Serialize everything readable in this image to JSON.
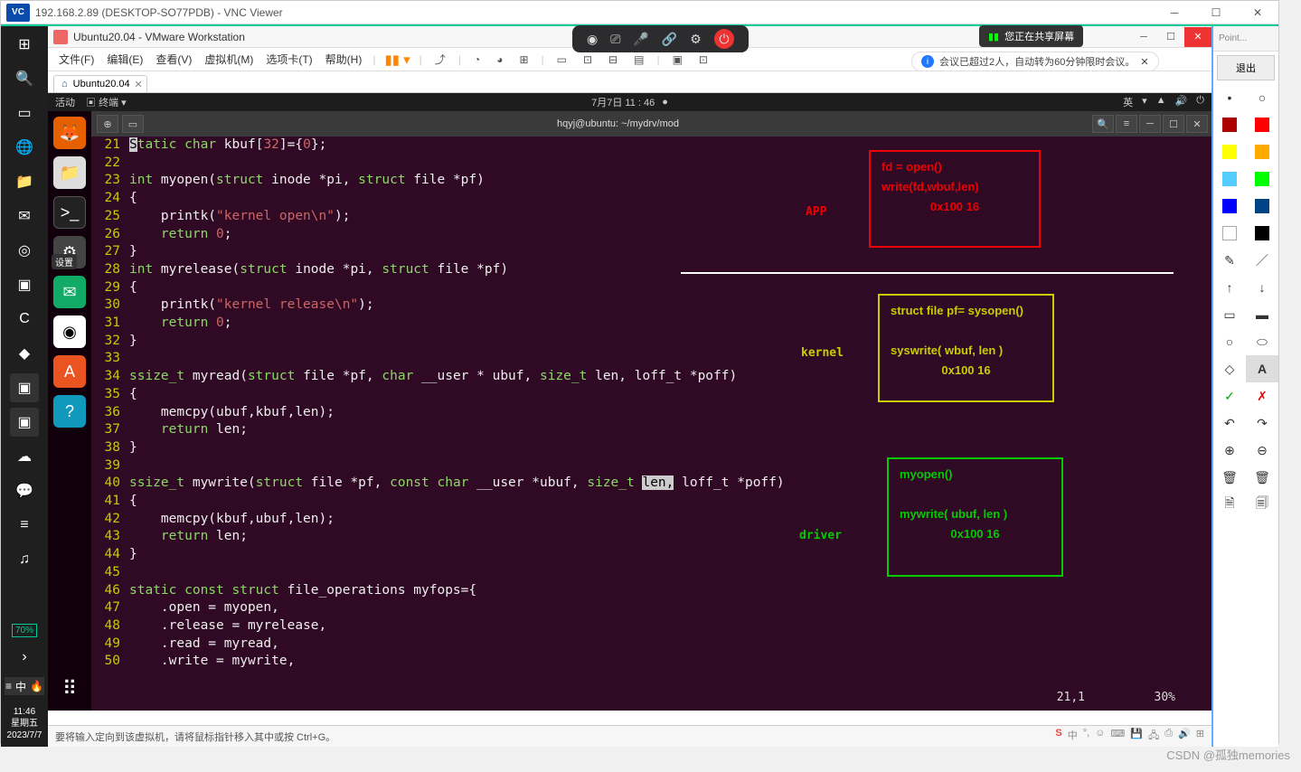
{
  "vnc": {
    "logo": "VC",
    "title": "192.168.2.89 (DESKTOP-SO77PDB) - VNC Viewer"
  },
  "annot_panel": {
    "top_text": "Point...",
    "exit": "退出"
  },
  "vmware": {
    "title": "Ubuntu20.04 - VMware Workstation",
    "menu": [
      "文件(F)",
      "编辑(E)",
      "查看(V)",
      "虚拟机(M)",
      "选项卡(T)",
      "帮助(H)"
    ],
    "tab": "Ubuntu20.04",
    "status": "要将输入定向到该虚拟机，请将鼠标指针移入其中或按 Ctrl+G。"
  },
  "sharing_pill": "您正在共享屏幕",
  "meeting_notice": "会议已超过2人，自动转为60分钟限时会议。",
  "ubuntu": {
    "activities": "活动",
    "app": "终端",
    "datetime": "7月7日 11 : 46",
    "ime": "英",
    "dock_badge": "设置"
  },
  "terminal": {
    "title": "hqyj@ubuntu: ~/mydrv/mod",
    "cursor_pos": "21,1",
    "percent": "30%"
  },
  "code": {
    "l21": {
      "n": "21",
      "a": "S",
      "b": "tatic ",
      "c": "char ",
      "d": "kbuf[",
      "e": "32",
      "f": "]={",
      "g": "0",
      "h": "};"
    },
    "l22": {
      "n": "22"
    },
    "l23": {
      "n": "23",
      "a": "int ",
      "b": "myopen(",
      "c": "struct ",
      "d": "inode *pi, ",
      "e": "struct ",
      "f": "file *pf)"
    },
    "l24": {
      "n": "24",
      "a": "{"
    },
    "l25": {
      "n": "25",
      "a": "    printk(",
      "b": "\"kernel open\\n\"",
      "c": ");"
    },
    "l26": {
      "n": "26",
      "a": "    ",
      "b": "return ",
      "c": "0",
      "d": ";"
    },
    "l27": {
      "n": "27",
      "a": "}"
    },
    "l28": {
      "n": "28",
      "a": "int ",
      "b": "myrelease(",
      "c": "struct ",
      "d": "inode *pi, ",
      "e": "struct ",
      "f": "file *pf)"
    },
    "l29": {
      "n": "29",
      "a": "{"
    },
    "l30": {
      "n": "30",
      "a": "    printk(",
      "b": "\"kernel release\\n\"",
      "c": ");"
    },
    "l31": {
      "n": "31",
      "a": "    ",
      "b": "return ",
      "c": "0",
      "d": ";"
    },
    "l32": {
      "n": "32",
      "a": "}"
    },
    "l33": {
      "n": "33"
    },
    "l34": {
      "n": "34",
      "a": "ssize_t ",
      "b": "myread(",
      "c": "struct ",
      "d": "file *pf, ",
      "e": "char ",
      "f": "__user * ubuf, ",
      "g": "size_t ",
      "h": "len, loff_t *poff)"
    },
    "l35": {
      "n": "35",
      "a": "{"
    },
    "l36": {
      "n": "36",
      "a": "    memcpy(ubuf,kbuf,len);"
    },
    "l37": {
      "n": "37",
      "a": "    ",
      "b": "return ",
      "c": "len;"
    },
    "l38": {
      "n": "38",
      "a": "}"
    },
    "l39": {
      "n": "39"
    },
    "l40": {
      "n": "40",
      "a": "ssize_t ",
      "b": "mywrite(",
      "c": "struct ",
      "d": "file *pf, ",
      "e": "const char ",
      "f": "__user *ubuf, ",
      "g": "size_t ",
      "h": "len,",
      "i": " loff_t *poff)"
    },
    "l41": {
      "n": "41",
      "a": "{"
    },
    "l42": {
      "n": "42",
      "a": "    memcpy(kbuf,ubuf,len);"
    },
    "l43": {
      "n": "43",
      "a": "    ",
      "b": "return ",
      "c": "len;"
    },
    "l44": {
      "n": "44",
      "a": "}"
    },
    "l45": {
      "n": "45"
    },
    "l46": {
      "n": "46",
      "a": "static const struct ",
      "b": "file_operations myfops={"
    },
    "l47": {
      "n": "47",
      "a": "    .open = myopen,"
    },
    "l48": {
      "n": "48",
      "a": "    .release = myrelease,"
    },
    "l49": {
      "n": "49",
      "a": "    .read = myread,"
    },
    "l50": {
      "n": "50",
      "a": "    .write = mywrite,"
    }
  },
  "overlay": {
    "app_label": "APP",
    "kernel_label": "kernel",
    "driver_label": "driver",
    "app": {
      "l1": "fd = open()",
      "l2": "write(fd,wbuf,len)",
      "l3": "0x100   16"
    },
    "kernel": {
      "l1": "struct file pf= sysopen()",
      "l2": "syswrite(  wbuf,  len   )",
      "l3": "0x100  16"
    },
    "driver": {
      "l1": "myopen()",
      "l2": "mywrite(  ubuf,  len     )",
      "l3": "0x100  16"
    }
  },
  "win_tb": {
    "battery": "70%",
    "time": "11:46",
    "day": "星期五",
    "date": "2023/7/7"
  },
  "watermark": "CSDN @孤独memories"
}
